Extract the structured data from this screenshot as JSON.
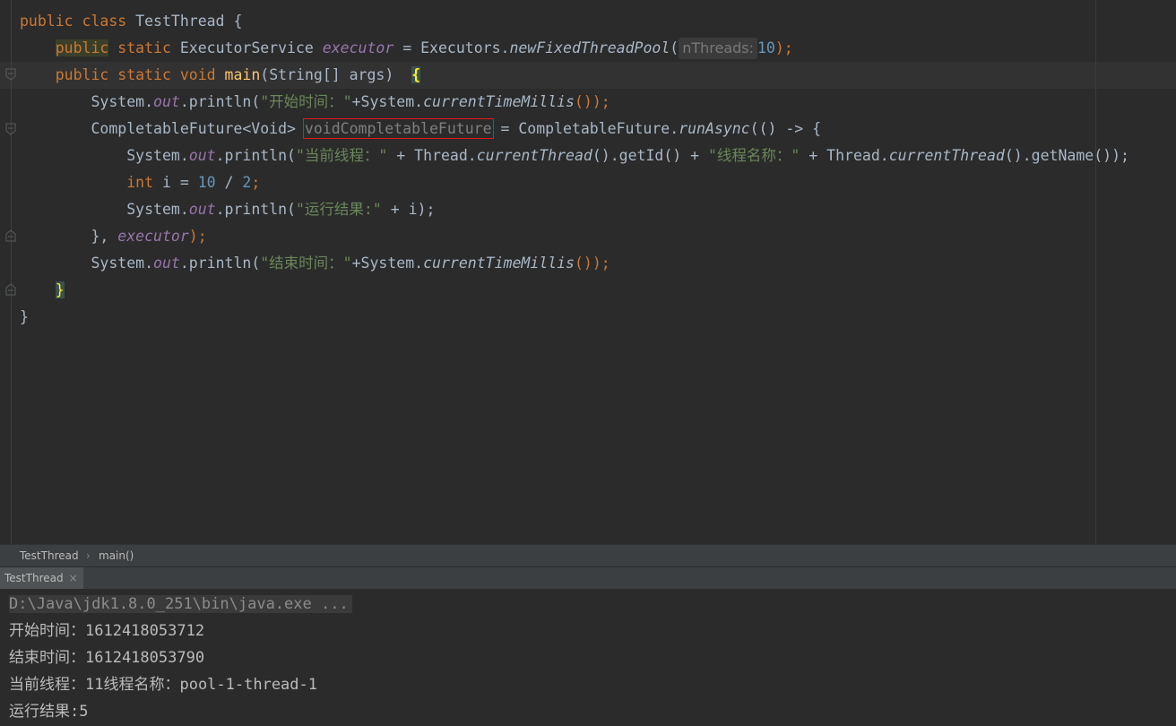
{
  "editor": {
    "lines": [
      [
        "public",
        "class",
        "TestThread",
        "{"
      ],
      [
        "public",
        "static",
        "ExecutorService",
        "executor",
        "=",
        "Executors.",
        "newFixedThreadPool",
        "(",
        "nThreads:",
        "10",
        ");"
      ],
      [
        "public",
        "static",
        "void",
        "main",
        "(String[] args)",
        "{"
      ],
      [
        "System.",
        "out",
        ".println(",
        "\"开始时间：\"",
        "+System.",
        "currentTimeMillis",
        "());"
      ],
      [
        "CompletableFuture<Void>",
        "voidCompletableFuture",
        "= CompletableFuture.",
        "runAsync",
        "(() -> {"
      ],
      [
        "System.",
        "out",
        ".println(",
        "\"当前线程：\"",
        "+ Thread.",
        "currentThread",
        "().getId() +",
        "\"线程名称：\"",
        "+ Thread.",
        "currentThread",
        "().getName());"
      ],
      [
        "int",
        "i = ",
        "10",
        "/ ",
        "2",
        ";"
      ],
      [
        "System.",
        "out",
        ".println(",
        "\"运行结果:\"",
        "+ i);"
      ],
      [
        "},",
        "executor",
        ");"
      ],
      [
        "System.",
        "out",
        ".println(",
        "\"结束时间：\"",
        "+System.",
        "currentTimeMillis",
        "());"
      ],
      [
        "}"
      ],
      [
        "}"
      ]
    ]
  },
  "breadcrumb": {
    "class": "TestThread",
    "method": "main()"
  },
  "run_tab": {
    "label": "TestThread",
    "close": "×"
  },
  "console": {
    "command": "D:\\Java\\jdk1.8.0_251\\bin\\java.exe ...",
    "output": [
      "开始时间：1612418053712",
      "结束时间：1612418053790",
      "当前线程：11线程名称：pool-1-thread-1",
      "运行结果:5"
    ]
  },
  "colors": {
    "background": "#2b2b2b",
    "keyword": "#cc7832",
    "string": "#6a8759",
    "number": "#6897bb",
    "field": "#9876aa",
    "method_decl": "#ffc66d",
    "highlight_box": "#e8141b"
  },
  "icons": [
    "fold-icon",
    "close-icon",
    "chevron-right-icon"
  ]
}
